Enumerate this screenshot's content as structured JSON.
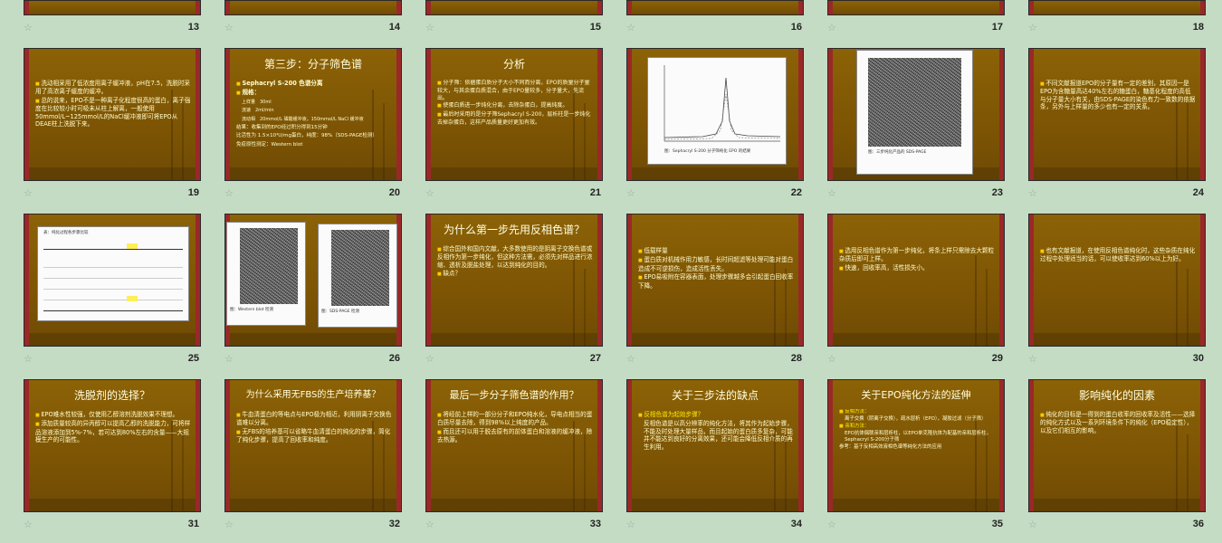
{
  "row0": [
    {
      "num": "13"
    },
    {
      "num": "14"
    },
    {
      "num": "15"
    },
    {
      "num": "16"
    },
    {
      "num": "17"
    },
    {
      "num": "18"
    }
  ],
  "slides": {
    "s19": {
      "num": "19",
      "lines": [
        "洗动相采用了低浓度用离子缓冲液，pH在7.5，洗脱时采用了高浓离子缓度的缓冲。",
        "总的说来，EPO不是一种离子化程度很高的蛋白，离子强度在比较较小时可吸未从柱上解离，一般使用50mmol/L~125mmol/L的NaCl缓冲液即可将EPO从DEAE柱上洗脱下来。"
      ]
    },
    "s20": {
      "num": "20",
      "title": "第三步：分子筛色谱",
      "lines": [
        "Sephacryl S-200 色谱分离",
        "规格：",
        "上样量　30ml",
        "流速　2ml/min",
        "流动相　20mmol/L 磷酸缓冲液，150mmol/L NaCl 缓冲液",
        "结果：收集到的EPO经过积分得到15分钟",
        "比活性为 1.5×10⁴U/mg蛋白，纯度：98%（SDS-PAGE检测）",
        "免疫原性测定：Western blot"
      ]
    },
    "s21": {
      "num": "21",
      "title": "分析",
      "lines": [
        "分子筛：依据蛋白质分子大小不同而分离，EPO的质量分子量较大，与其余蛋白质混合，由于EPO量较多，分子量大，先流出。",
        "使蛋白质进一步纯化分离，去除杂蛋白，提高纯度。",
        "最后时采用的是分子筛Sephacryl S-200，层析柱是一步纯化去掉杂蛋白，这样产品质量更好更加有效。"
      ]
    },
    "s22": {
      "num": "22",
      "caption": "图：Sephacryl S-200 分子筛纯化 EPO 的结果"
    },
    "s23": {
      "num": "23",
      "caption": "图：三步纯化产品的 SDS-PAGE"
    },
    "s24": {
      "num": "24",
      "lines": [
        "不同文献报道EPO的分子量有一定的差别，其原因一是EPO为含糖量高达40%左右的糖蛋白，糖基化程度的高低与分子量大小有关，由SDS-PAGE的染色有力一致数的依据条，另外与上样量的多少也有一定的关系。"
      ]
    },
    "s25": {
      "num": "25",
      "header": "表：纯化过程各步骤比较"
    },
    "s26": {
      "num": "26",
      "cap1": "图：Western blot 检测",
      "cap2": "图：SDS-PAGE 检测"
    },
    "s27": {
      "num": "27",
      "title": "为什么第一步先用反相色谱？",
      "lines": [
        "综合国外和国内文献，大多数使用的是阴离子交换色谱或反相作为第一步纯化，但这种方法需，必须先对样品进行浓缩、透析及脱盐处理，以达到纯化的目的。",
        "缺点？"
      ]
    },
    "s28": {
      "num": "28",
      "lines": [
        "低载样量",
        "蛋白质对机械作用力敏感，长时间超滤等处理可能对蛋白造成不可逆损伤，造成活性丢失。",
        "EPO易吸附在容器表面，处理步骤越多会引起蛋白回收率下降。"
      ]
    },
    "s29": {
      "num": "29",
      "lines": [
        "选用反相色谱作为第一步纯化，将条上样只需除去大颗粒杂质后即可上样。",
        "快速，回收率高，活性损失小。"
      ]
    },
    "s30": {
      "num": "30",
      "lines": [
        "也有文献报道，在使用反相色谱纯化时，这些杂质在纯化过程中处理适当的话，可以使收率达到60%以上为好。"
      ]
    },
    "s31": {
      "num": "31",
      "title": "洗脱剂的选择？",
      "lines": [
        "EPO难水性较强，仅使用乙醇溶剂洗脱效果不理想。",
        "添加质量较高的异丙醇可以提高乙醇的洗脱能力，可将样品溶液添加到5%-7%，若可达到80%左右的含量——大规模生产的可能性。"
      ]
    },
    "s32": {
      "num": "32",
      "title": "为什么采用无FBS的生产培养基？",
      "lines": [
        "牛血清蛋白的等电点与EPO极为相近，利用阴离子交换色谱难以分离。",
        "无FBS的培养基可以省略牛血清蛋白的纯化的步骤，简化了纯化步骤，提高了回收率和纯度。"
      ]
    },
    "s33": {
      "num": "33",
      "title": "最后一步分子筛色谱的作用？",
      "lines": [
        "将经前上样的一部分分子和EPO纯水化，导电点相当的蛋白质尽量去除，得到98%以上纯度的产品。",
        "而且还可以用于脱去原有的前体蛋白和溶液的缓冲液，除去热源。"
      ]
    },
    "s34": {
      "num": "34",
      "title": "关于三步法的缺点",
      "lines": [
        "反相色谱为起始步骤？",
        "反相色谱是以高分辨率的纯化方法，将其作为起始步骤，不能及时处理大量样品，而且起始的蛋白质多复杂，可能并不能达到良好的分离效果，还可能会降低反相介质的再生利用。"
      ]
    },
    "s35": {
      "num": "35",
      "title": "关于EPO纯化方法的延伸",
      "lines": [
        "反相方法：",
        "离子交换（阴离子交换），疏水层析（EPO），凝胶过滤（分子筛）",
        "亲和方法：",
        "EPO抗体偶联亲和层析柱，以EPO单克隆抗体为配基的亲和层析柱，Sephacryl S-200分子筛",
        "参考：基于反相高效液相色谱等纯化方法的应用"
      ]
    },
    "s36": {
      "num": "36",
      "title": "影响纯化的因素",
      "lines": [
        "纯化的目标是一得到的蛋白收率的回收率及活性——选择的纯化方式以及一系列环境条件下的纯化（EPO稳定性），以及它们相互的影响。"
      ]
    }
  },
  "colors": {
    "page_bg": "#c4dcc4",
    "slide_bg": "#865c04",
    "side_bar": "#9a2828",
    "title": "#ffffe0",
    "highlight": "#ffee00"
  }
}
